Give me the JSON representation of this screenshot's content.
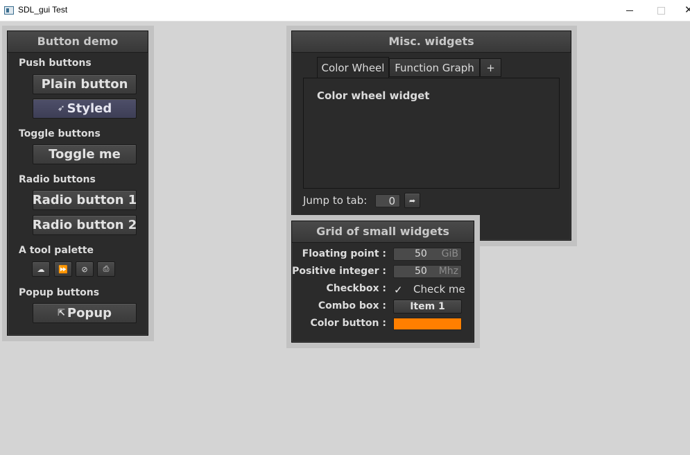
{
  "app": {
    "title": "SDL_gui Test"
  },
  "button_demo": {
    "title": "Button demo",
    "push_label": "Push buttons",
    "plain_button": "Plain button",
    "styled_button": "Styled",
    "toggle_label": "Toggle buttons",
    "toggle_button": "Toggle me",
    "radio_label": "Radio buttons",
    "radio1": "Radio button 1",
    "radio2": "Radio button 2",
    "palette_label": "A tool palette",
    "tools": [
      "cloud-icon",
      "fast-forward-icon",
      "compass-icon",
      "install-icon"
    ],
    "popup_label": "Popup buttons",
    "popup_button": "Popup"
  },
  "misc": {
    "title": "Misc. widgets",
    "tabs": [
      "Color Wheel",
      "Function Graph",
      "+"
    ],
    "active_tab": "Color Wheel",
    "panel_text": "Color wheel widget",
    "jump_label": "Jump to tab:",
    "jump_value": "0"
  },
  "grid": {
    "title": "Grid of small widgets",
    "float_label": "Floating point :",
    "float_value": "50",
    "float_units": "GiB",
    "int_label": "Positive integer :",
    "int_value": "50",
    "int_units": "Mhz",
    "checkbox_label": "Checkbox :",
    "checkbox_text": "Check me",
    "checkbox_checked": true,
    "combo_label": "Combo box :",
    "combo_value": "Item 1",
    "color_label": "Color button :",
    "color_value": "#ff7f00"
  }
}
